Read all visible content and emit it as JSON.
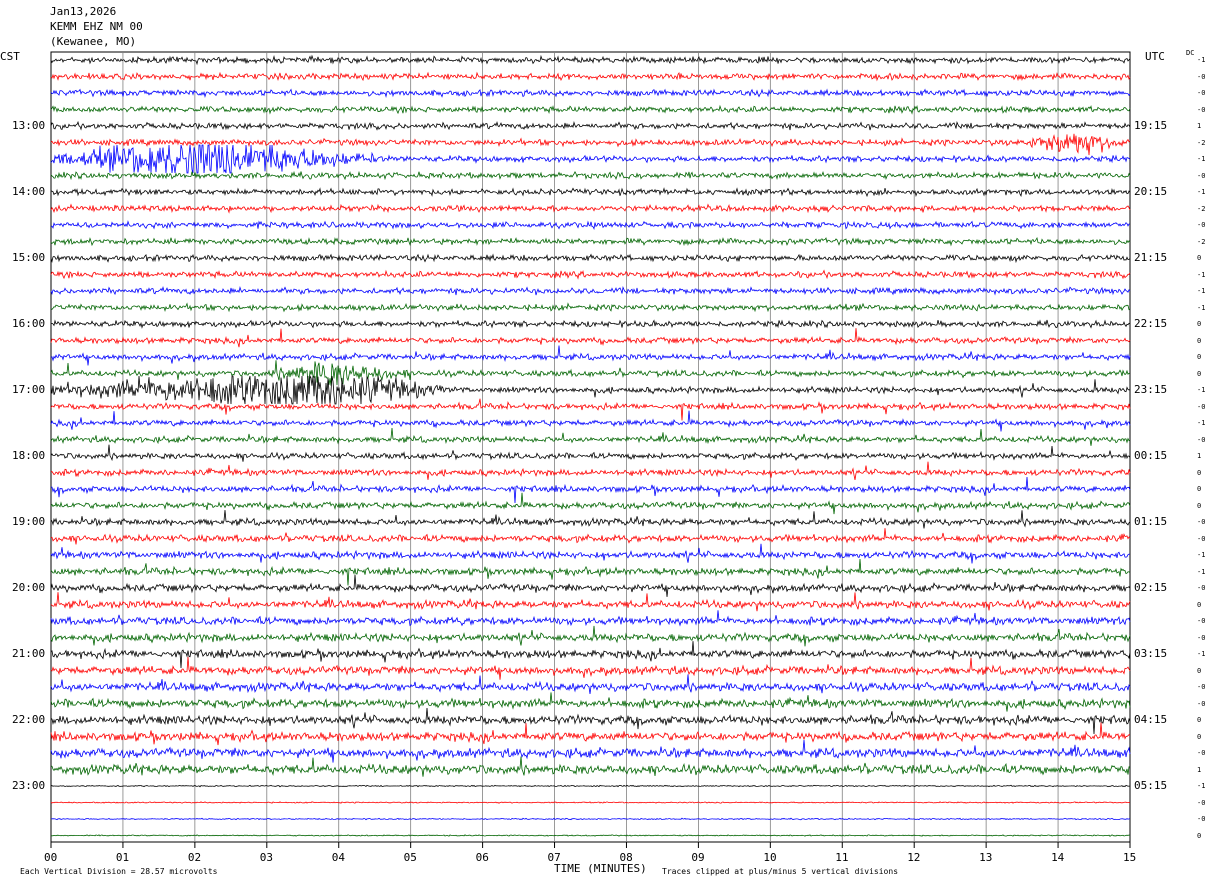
{
  "header": {
    "date": "Jan13,2026",
    "station": "KEMM EHZ NM 00",
    "location": "(Kewanee, MO)"
  },
  "left_timezone": "CST",
  "right_timezone": "UTC",
  "dc_header": "DC",
  "colors": {
    "trace_cycle": [
      "#000000",
      "#ff0000",
      "#0000ff",
      "#006400"
    ],
    "gridline": "#808080"
  },
  "chart_data": {
    "type": "line",
    "title": "",
    "xlabel": "TIME (MINUTES)",
    "ylabel": "",
    "xlim": [
      0,
      15
    ],
    "x_ticks": [
      "00",
      "01",
      "02",
      "03",
      "04",
      "05",
      "06",
      "07",
      "08",
      "09",
      "10",
      "11",
      "12",
      "13",
      "14",
      "15"
    ],
    "left_hour_labels": [
      "13:00",
      "14:00",
      "15:00",
      "16:00",
      "17:00",
      "18:00",
      "19:00",
      "20:00",
      "21:00",
      "22:00",
      "23:00"
    ],
    "right_hour_labels": [
      "19:15",
      "20:15",
      "21:15",
      "22:15",
      "23:15",
      "00:15",
      "01:15",
      "02:15",
      "03:15",
      "04:15",
      "05:15"
    ],
    "first_labeled_trace": 4,
    "trace_count": 48,
    "traces_per_hour": 4,
    "dc_offsets": [
      "-1",
      "-0",
      "-0",
      "-0",
      "1",
      "-2",
      "-1",
      "-0",
      "-1",
      "-2",
      "-0",
      "-2",
      "0",
      "-1",
      "-1",
      "-1",
      "0",
      "0",
      "0",
      "0",
      "-1",
      "-0",
      "-1",
      "-0",
      "1",
      "0",
      "0",
      "0",
      "-0",
      "-0",
      "-1",
      "-1",
      "-0",
      "0",
      "-0",
      "-0",
      "-1",
      "0",
      "-0",
      "-0",
      "0",
      "0",
      "-0",
      "1",
      "-1",
      "-0",
      "-0",
      "0"
    ],
    "events": [
      {
        "trace": 6,
        "start_min": 0.0,
        "end_min": 4.5,
        "peak_min": 2.0,
        "amplitude": "large"
      },
      {
        "trace": 5,
        "start_min": 13.5,
        "end_min": 15.0,
        "peak_min": 14.2,
        "amplitude": "moderate"
      },
      {
        "trace": 20,
        "start_min": 0.0,
        "end_min": 5.5,
        "peak_min": 3.5,
        "amplitude": "large"
      },
      {
        "trace": 19,
        "start_min": 3.0,
        "end_min": 5.0,
        "peak_min": 3.8,
        "amplitude": "moderate"
      }
    ],
    "quiet_traces_from": 44,
    "footer": {
      "scale_label": "Each Vertical Division =",
      "scale_value": "28.57 microvolts",
      "clip_note": "Traces clipped at plus/minus 5 vertical divisions"
    },
    "grid": "vertical minute lines"
  }
}
